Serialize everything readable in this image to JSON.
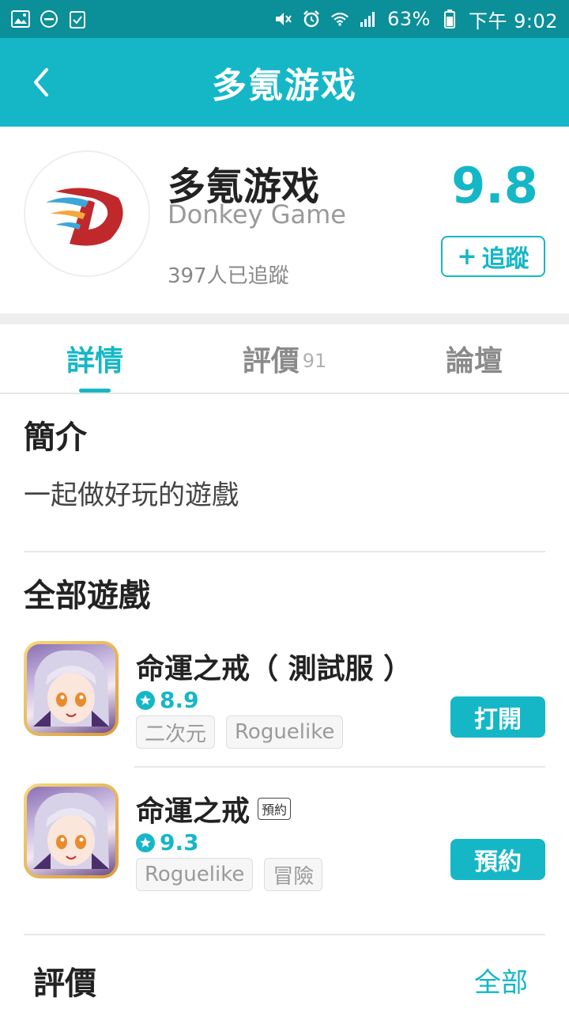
{
  "status_bar": {
    "battery": "63%",
    "time": "下午 9:02"
  },
  "header": {
    "title": "多氪游戏"
  },
  "developer": {
    "name": "多氪游戏",
    "subtitle": "Donkey Game",
    "followers": "397人已追蹤",
    "score": "9.8",
    "follow_label": "追蹤"
  },
  "tabs": [
    {
      "label": "詳情",
      "count": ""
    },
    {
      "label": "評價",
      "count": "91"
    },
    {
      "label": "論壇",
      "count": ""
    }
  ],
  "intro": {
    "title": "簡介",
    "text": "一起做好玩的遊戲"
  },
  "games_section": {
    "title": "全部遊戲"
  },
  "games": [
    {
      "name": "命運之戒（ 測試服 ）",
      "badge": "",
      "rating": "8.9",
      "tags": [
        "二次元",
        "Roguelike"
      ],
      "action": "打開"
    },
    {
      "name": "命運之戒",
      "badge": "預約",
      "rating": "9.3",
      "tags": [
        "Roguelike",
        "冒險"
      ],
      "action": "預約"
    }
  ],
  "reviews_section": {
    "title": "評價",
    "all_label": "全部"
  },
  "colors": {
    "accent": "#15b7c7",
    "status_bar": "#0b8f99"
  }
}
